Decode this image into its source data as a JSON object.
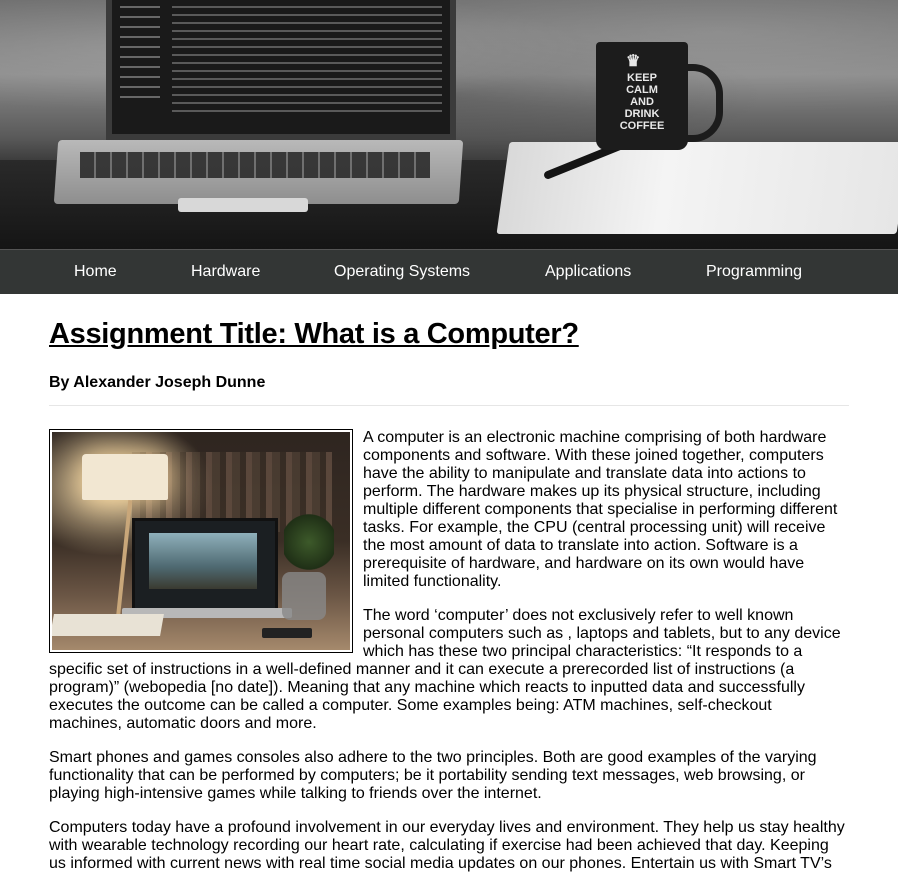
{
  "nav": {
    "items": [
      "Home",
      "Hardware",
      "Operating Systems",
      "Applications",
      "Programming"
    ]
  },
  "hero": {
    "mug_text": [
      "KEEP",
      "CALM",
      "AND",
      "DRINK",
      "COFFEE"
    ]
  },
  "article": {
    "title": "Assignment Title: What is a Computer?",
    "author": "By Alexander Joseph Dunne",
    "paragraphs": [
      "A computer is an electronic machine comprising of both hardware components and software. With these joined together, computers have the ability to manipulate and translate data into actions to perform. The hardware makes up its physical structure, including multiple different components that specialise in performing different tasks. For example, the CPU (central processing unit) will receive the most amount of data to translate into action. Software is a prerequisite of hardware, and hardware on its own would have limited functionality.",
      "The word ‘computer’ does not exclusively refer to well known personal computers such as , laptops and tablets, but to any device which has these two principal characteristics: “It responds to a specific set of instructions in a well-defined manner and it can execute a prerecorded list of instructions (a program)” (webopedia [no date]). Meaning that any machine which reacts to inputted data and successfully executes the outcome can be called a computer. Some examples being: ATM machines, self-checkout machines, automatic doors and more.",
      "Smart phones and games consoles also adhere to the two principles. Both are good examples of the varying functionality that can be performed by computers; be it portability sending text messages, web browsing, or playing high-intensive games while talking to friends over the internet.",
      "Computers today have a profound involvement in our everyday lives and environment. They help us stay healthy with wearable technology recording our heart rate, calculating if exercise had been achieved that day. Keeping us informed with current news with real time social media updates on our phones. Entertain us with Smart TV’s"
    ]
  }
}
